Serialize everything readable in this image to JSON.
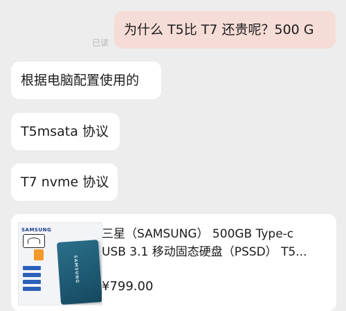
{
  "messages": [
    {
      "side": "right",
      "text": "为什么 T5比 T7 还贵呢？500 G"
    },
    {
      "side": "left",
      "text": "根据电脑配置使用的"
    },
    {
      "side": "left",
      "text": "T5msata 协议"
    },
    {
      "side": "left",
      "text": "T7 nvme 协议"
    }
  ],
  "read_status": "已读",
  "product_card": {
    "title_line1": "三星（SAMSUNG） 500GB Type-c",
    "title_line2": "USB 3.1 移动固态硬盘（PSSD） T5...",
    "price": "¥799.00",
    "brand": "SAMSUNG",
    "image_icon": "samsung-t5-ssd-product-image"
  }
}
